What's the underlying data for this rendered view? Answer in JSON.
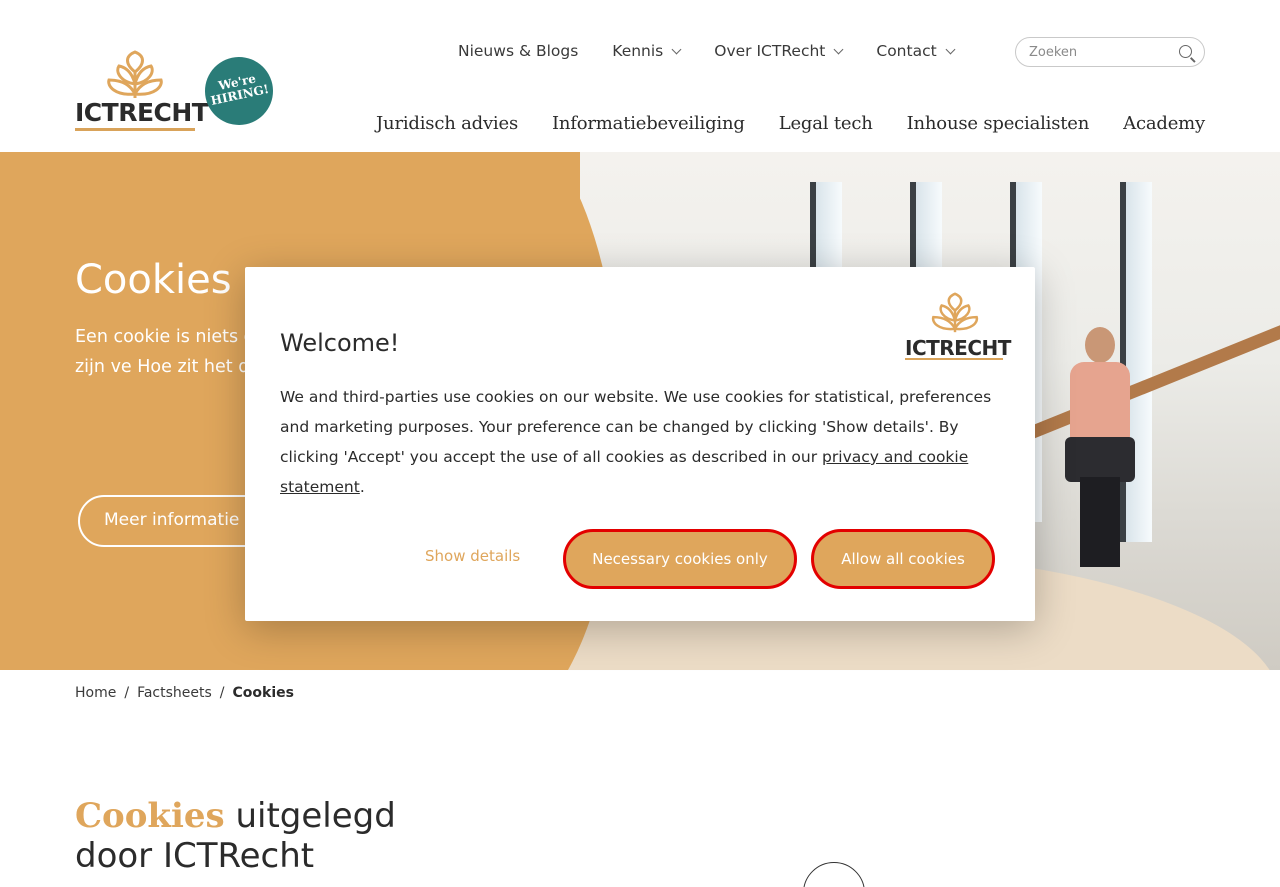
{
  "header": {
    "logo_text": "ICTRECHT",
    "hiring_line1": "We're",
    "hiring_line2": "HIRING!",
    "topnav": [
      {
        "label": "Nieuws & Blogs",
        "dropdown": false
      },
      {
        "label": "Kennis",
        "dropdown": true
      },
      {
        "label": "Over ICTRecht",
        "dropdown": true
      },
      {
        "label": "Contact",
        "dropdown": true
      }
    ],
    "search_placeholder": "Zoeken",
    "mainnav": [
      "Juridisch advies",
      "Informatiebeveiliging",
      "Legal tech",
      "Inhouse specialisten",
      "Academy"
    ]
  },
  "hero": {
    "title": "Cookies",
    "lede": "Een cookie is niets dat op de compute geplaatst. Er zijn ve Hoe zit het qua reg leest het in dit fact",
    "more_button": "Meer informatie"
  },
  "breadcrumb": [
    "Home",
    "Factsheets",
    "Cookies"
  ],
  "content": {
    "title_accent": "Cookies",
    "title_rest_1": "uitgelegd",
    "title_rest_2": "door ICTRecht"
  },
  "dialog": {
    "title": "Welcome!",
    "logo_text": "ICTRECHT",
    "body": "We and third-parties use cookies on our website. We use cookies for statistical, preferences and marketing purposes. Your preference can be changed by clicking 'Show details'. By clicking 'Accept' you accept the use of all cookies as described in our",
    "link": "privacy and cookie statement",
    "link_suffix": ".",
    "show_details": "Show details",
    "necessary_button": "Necessary cookies only",
    "allow_button": "Allow all cookies"
  },
  "colors": {
    "accent": "#dfa65c",
    "teal": "#2a7c78",
    "highlight_border": "#e30000"
  }
}
